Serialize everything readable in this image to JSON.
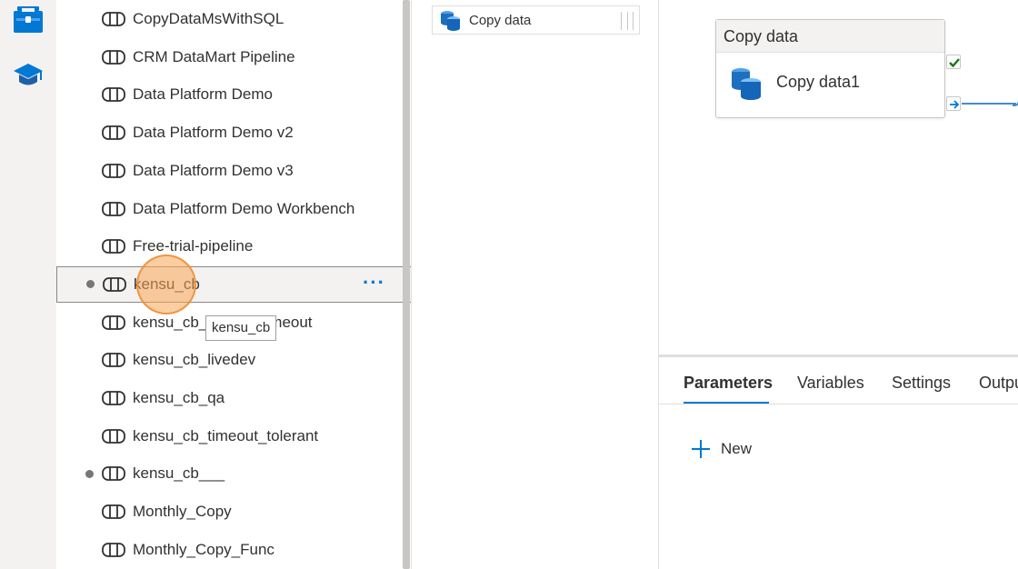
{
  "rail": {
    "items": [
      {
        "icon": "toolbox-icon"
      },
      {
        "icon": "learn-icon"
      }
    ]
  },
  "pipelines": {
    "items": [
      {
        "label": "CopyDataMsWithSQL",
        "unsaved": false
      },
      {
        "label": "CRM DataMart Pipeline",
        "unsaved": false
      },
      {
        "label": "Data Platform Demo",
        "unsaved": false
      },
      {
        "label": "Data Platform Demo v2",
        "unsaved": false
      },
      {
        "label": "Data Platform Demo v3",
        "unsaved": false
      },
      {
        "label": "Data Platform Demo Workbench",
        "unsaved": false
      },
      {
        "label": "Free-trial-pipeline",
        "unsaved": false
      },
      {
        "label": "kensu_cb",
        "unsaved": true,
        "selected": true
      },
      {
        "label": "kensu_cb_fail_on_timeout",
        "unsaved": false
      },
      {
        "label": "kensu_cb_livedev",
        "unsaved": false
      },
      {
        "label": "kensu_cb_qa",
        "unsaved": false
      },
      {
        "label": "kensu_cb_timeout_tolerant",
        "unsaved": false
      },
      {
        "label": "kensu_cb___",
        "unsaved": true
      },
      {
        "label": "Monthly_Copy",
        "unsaved": false
      },
      {
        "label": "Monthly_Copy_Func",
        "unsaved": false
      }
    ],
    "more_label": "···",
    "tooltip": "kensu_cb"
  },
  "activities": {
    "item_label": "Copy data"
  },
  "canvas": {
    "node_type": "Copy data",
    "node_name": "Copy data1"
  },
  "panel": {
    "tabs": [
      "Parameters",
      "Variables",
      "Settings",
      "Outpu"
    ],
    "active_tab": "Parameters",
    "new_label": "New"
  },
  "colors": {
    "accent": "#0078d4",
    "success": "#107c10",
    "cursor_highlight": "#f7a554"
  }
}
